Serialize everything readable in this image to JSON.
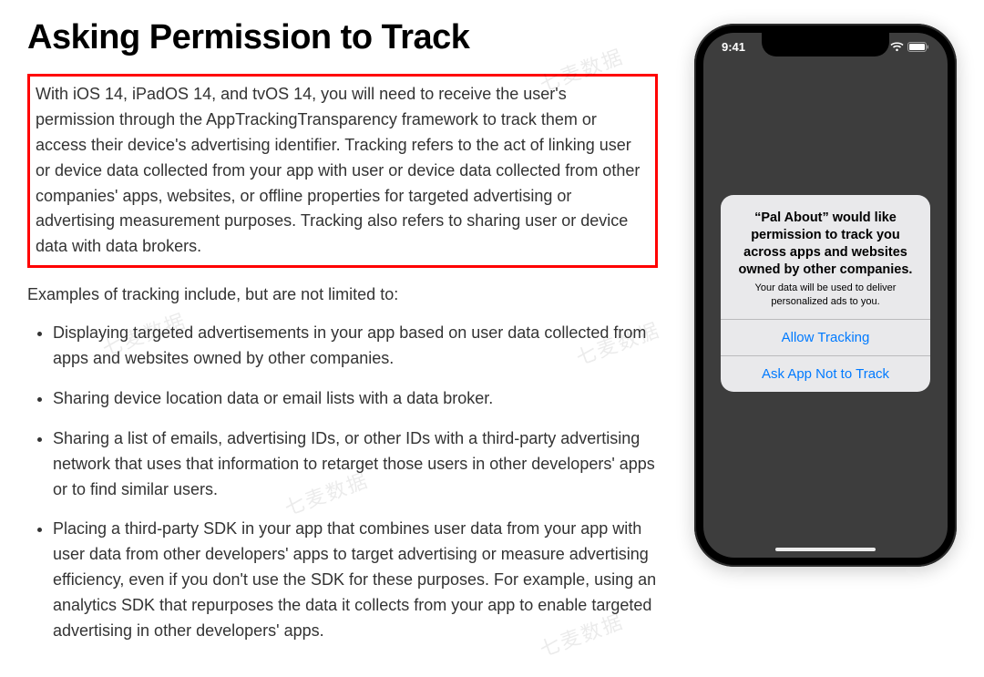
{
  "page": {
    "title": "Asking Permission to Track",
    "intro": "With iOS 14, iPadOS 14, and tvOS 14, you will need to receive the user's permission through the AppTrackingTransparency framework to track them or access their device's advertising identifier. Tracking refers to the act of linking user or device data collected from your app with user or device data collected from other companies' apps, websites, or offline properties for targeted advertising or advertising measurement purposes. Tracking also refers to sharing user or device data with data brokers.",
    "examples_lead": "Examples of tracking include, but are not limited to:",
    "examples": [
      "Displaying targeted advertisements in your app based on user data collected from apps and websites owned by other companies.",
      "Sharing device location data or email lists with a data broker.",
      "Sharing a list of emails, advertising IDs, or other IDs with a third-party advertising network that uses that information to retarget those users in other developers' apps or to find similar users.",
      "Placing a third-party SDK in your app that combines user data from your app with user data from other developers' apps to target advertising or measure advertising efficiency, even if you don't use the SDK for these purposes. For example, using an analytics SDK that repurposes the data it collects from your app to enable targeted advertising in other developers' apps."
    ]
  },
  "phone": {
    "time": "9:41",
    "dialog": {
      "title": "“Pal About” would like permission to track you across apps and websites owned by other companies.",
      "subtitle": "Your data will be used to deliver personalized ads to you.",
      "allow": "Allow Tracking",
      "deny": "Ask App Not to Track"
    }
  },
  "watermark_text": "七麦数据"
}
